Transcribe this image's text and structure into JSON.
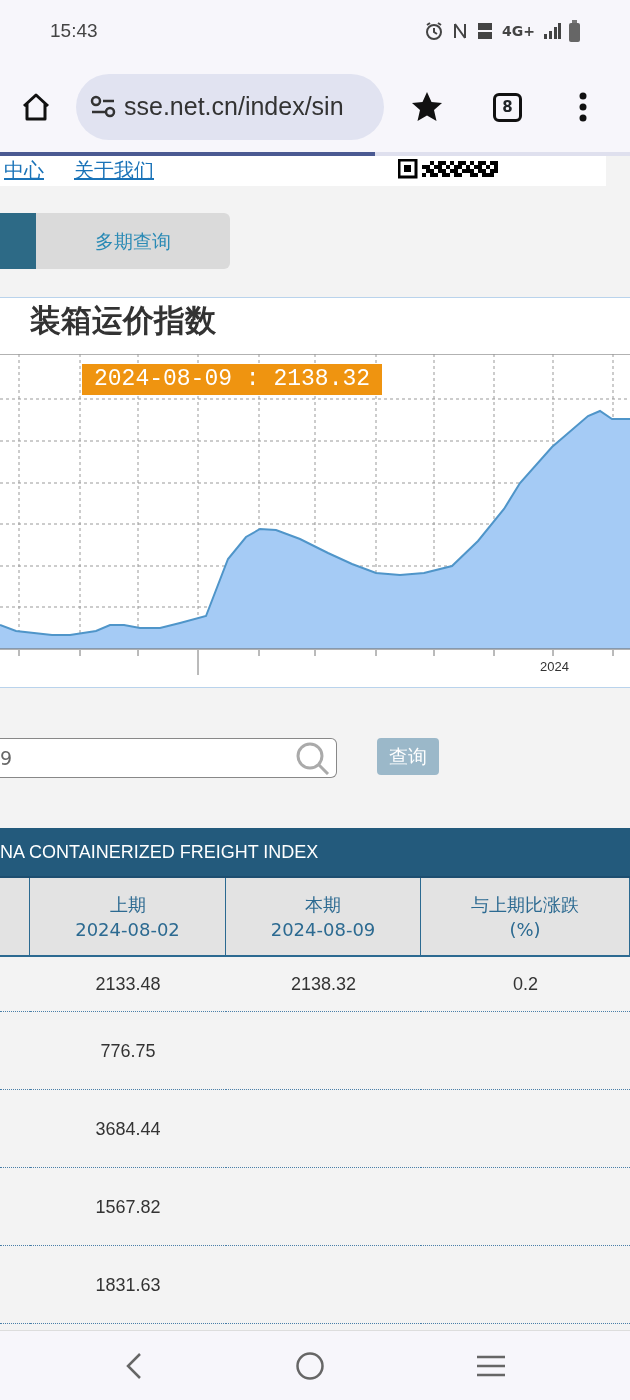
{
  "status_bar": {
    "time": "15:43",
    "network": "4G+"
  },
  "browser": {
    "url": "sse.net.cn/index/sin",
    "tab_count": "8",
    "page_load": {
      "level": 0.595
    }
  },
  "site_nav": {
    "links": [
      "中心",
      "关于我们"
    ]
  },
  "tabs": [
    {
      "selected": true
    },
    {
      "label": "多期查询",
      "selected": false
    }
  ],
  "chart": {
    "title": "装箱运价指数",
    "tooltip": "2024-08-09 : 2138.32",
    "x_label": "2024"
  },
  "query": {
    "date_value": "9",
    "button": "查询"
  },
  "table": {
    "title": "NA CONTAINERIZED FREIGHT INDEX",
    "columns": [
      {
        "title": "上期",
        "date": "2024-08-02"
      },
      {
        "title": "本期",
        "date": "2024-08-09"
      },
      {
        "title": "与上期比涨跌",
        "date": "(%)"
      }
    ],
    "rows": [
      {
        "previous": "2133.48",
        "current": "2138.32",
        "change": "0.2"
      },
      {
        "previous": "776.75"
      },
      {
        "previous": "3684.44"
      },
      {
        "previous": "1567.82"
      },
      {
        "previous": "1831.63"
      }
    ]
  }
}
